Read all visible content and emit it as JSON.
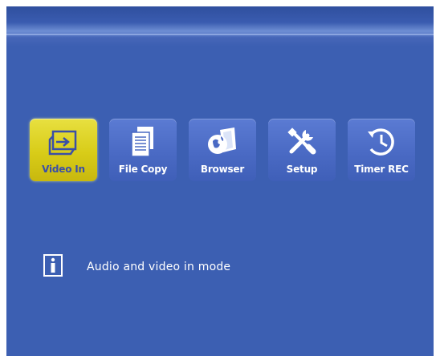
{
  "colors": {
    "background": "#3c5fb2",
    "tile": "#4a6ac4",
    "tile_active": "#d8cc18",
    "text": "#ffffff",
    "text_active": "#3a4fa8"
  },
  "menu": {
    "items": [
      {
        "label": "Video In",
        "icon": "video-in-icon",
        "selected": true
      },
      {
        "label": "File Copy",
        "icon": "file-copy-icon",
        "selected": false
      },
      {
        "label": "Browser",
        "icon": "browser-icon",
        "selected": false
      },
      {
        "label": "Setup",
        "icon": "setup-tools-icon",
        "selected": false
      },
      {
        "label": "Timer REC",
        "icon": "timer-clock-icon",
        "selected": false
      }
    ]
  },
  "info": {
    "icon": "info-icon",
    "text": "Audio and video in mode"
  }
}
